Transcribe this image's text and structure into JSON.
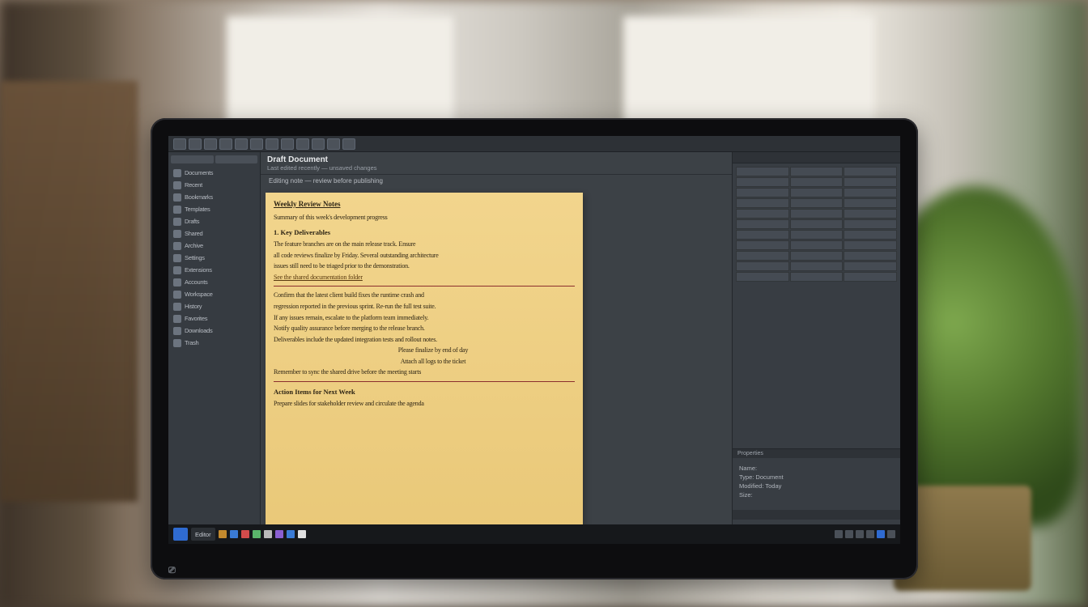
{
  "toolbar": {
    "buttons": 12
  },
  "sidebar": {
    "items": [
      {
        "label": "Documents"
      },
      {
        "label": "Recent"
      },
      {
        "label": "Bookmarks"
      },
      {
        "label": "Templates"
      },
      {
        "label": "Drafts"
      },
      {
        "label": "Shared"
      },
      {
        "label": "Archive"
      },
      {
        "label": "Settings"
      },
      {
        "label": "Extensions"
      },
      {
        "label": "Accounts"
      },
      {
        "label": "Workspace"
      },
      {
        "label": "History"
      },
      {
        "label": "Favorites"
      },
      {
        "label": "Downloads"
      },
      {
        "label": "Trash"
      }
    ]
  },
  "editor": {
    "title": "Draft Document",
    "subtitle": "Last edited recently — unsaved changes",
    "pre_note": "Editing note — review before publishing"
  },
  "note": {
    "h1": "Weekly Review Notes",
    "intro": "Summary of this week's development progress",
    "h2a": "1. Key Deliverables",
    "l1": "The feature branches are on the main release track. Ensure",
    "l2": "all code reviews finalize by Friday. Several outstanding architecture",
    "l3": "issues still need to be triaged prior to the demonstration.",
    "link": "See the shared documentation folder",
    "p1": "Confirm that the latest client build fixes the runtime crash and",
    "p2": "regression reported in the previous sprint. Re-run the full test suite.",
    "p3": "If any issues remain, escalate to the platform team immediately.",
    "p4": "Notify quality assurance before merging to the release branch.",
    "p5": "Deliverables include the updated integration tests and rollout notes.",
    "c1": "Please finalize by end of day",
    "c2": "Attach all logs to the ticket",
    "foot": "Remember to sync the shared drive before the meeting starts",
    "h2b": "Action Items for Next Week",
    "last": "Prepare slides for stakeholder review and circulate the agenda"
  },
  "rightpanel": {
    "tab": "Properties",
    "info": {
      "a": "Name:",
      "b": "Type: Document",
      "c": "Modified: Today",
      "d": "Size:"
    }
  },
  "taskbar": {
    "app": "Editor",
    "tray_count": 6
  },
  "monitor_brand": "⎚"
}
